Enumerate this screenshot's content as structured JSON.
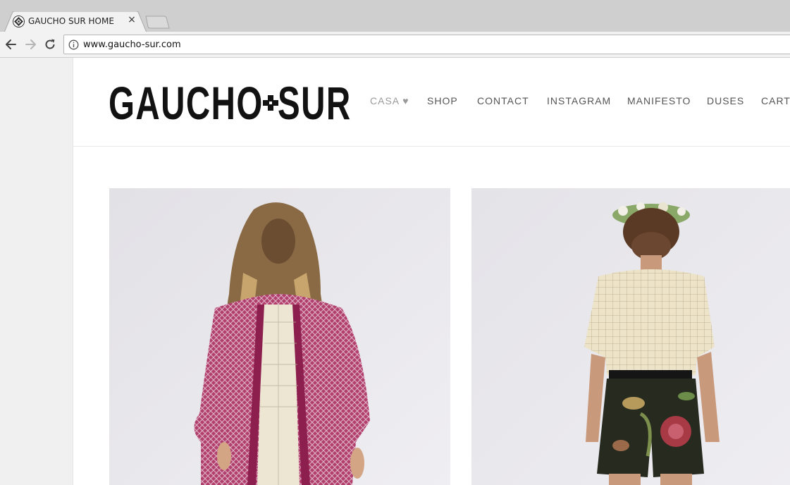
{
  "browser": {
    "tab_title": "GAUCHO SUR HOME",
    "tab_close": "×",
    "url": "www.gaucho-sur.com"
  },
  "site": {
    "logo_left": "GAUCHO",
    "logo_right": "SUR",
    "nav": [
      {
        "label": "CASA ♥",
        "active": true
      },
      {
        "label": "SHOP"
      },
      {
        "label": "CONTACT"
      },
      {
        "label": "INSTAGRAM"
      },
      {
        "label": "MANIFESTO"
      },
      {
        "label": "DUSES"
      },
      {
        "label": "CART"
      }
    ]
  },
  "colors": {
    "logo": "#121212",
    "nav": "#555555",
    "nav_active": "#9a9a9a",
    "poncho": "#b0406e",
    "photo_bg": "#e9e8ec"
  },
  "icons": {
    "favicon": "gaucho-sur-diamond-icon",
    "back": "arrow-left-icon",
    "forward": "arrow-right-icon",
    "reload": "reload-icon",
    "info": "info-icon"
  }
}
